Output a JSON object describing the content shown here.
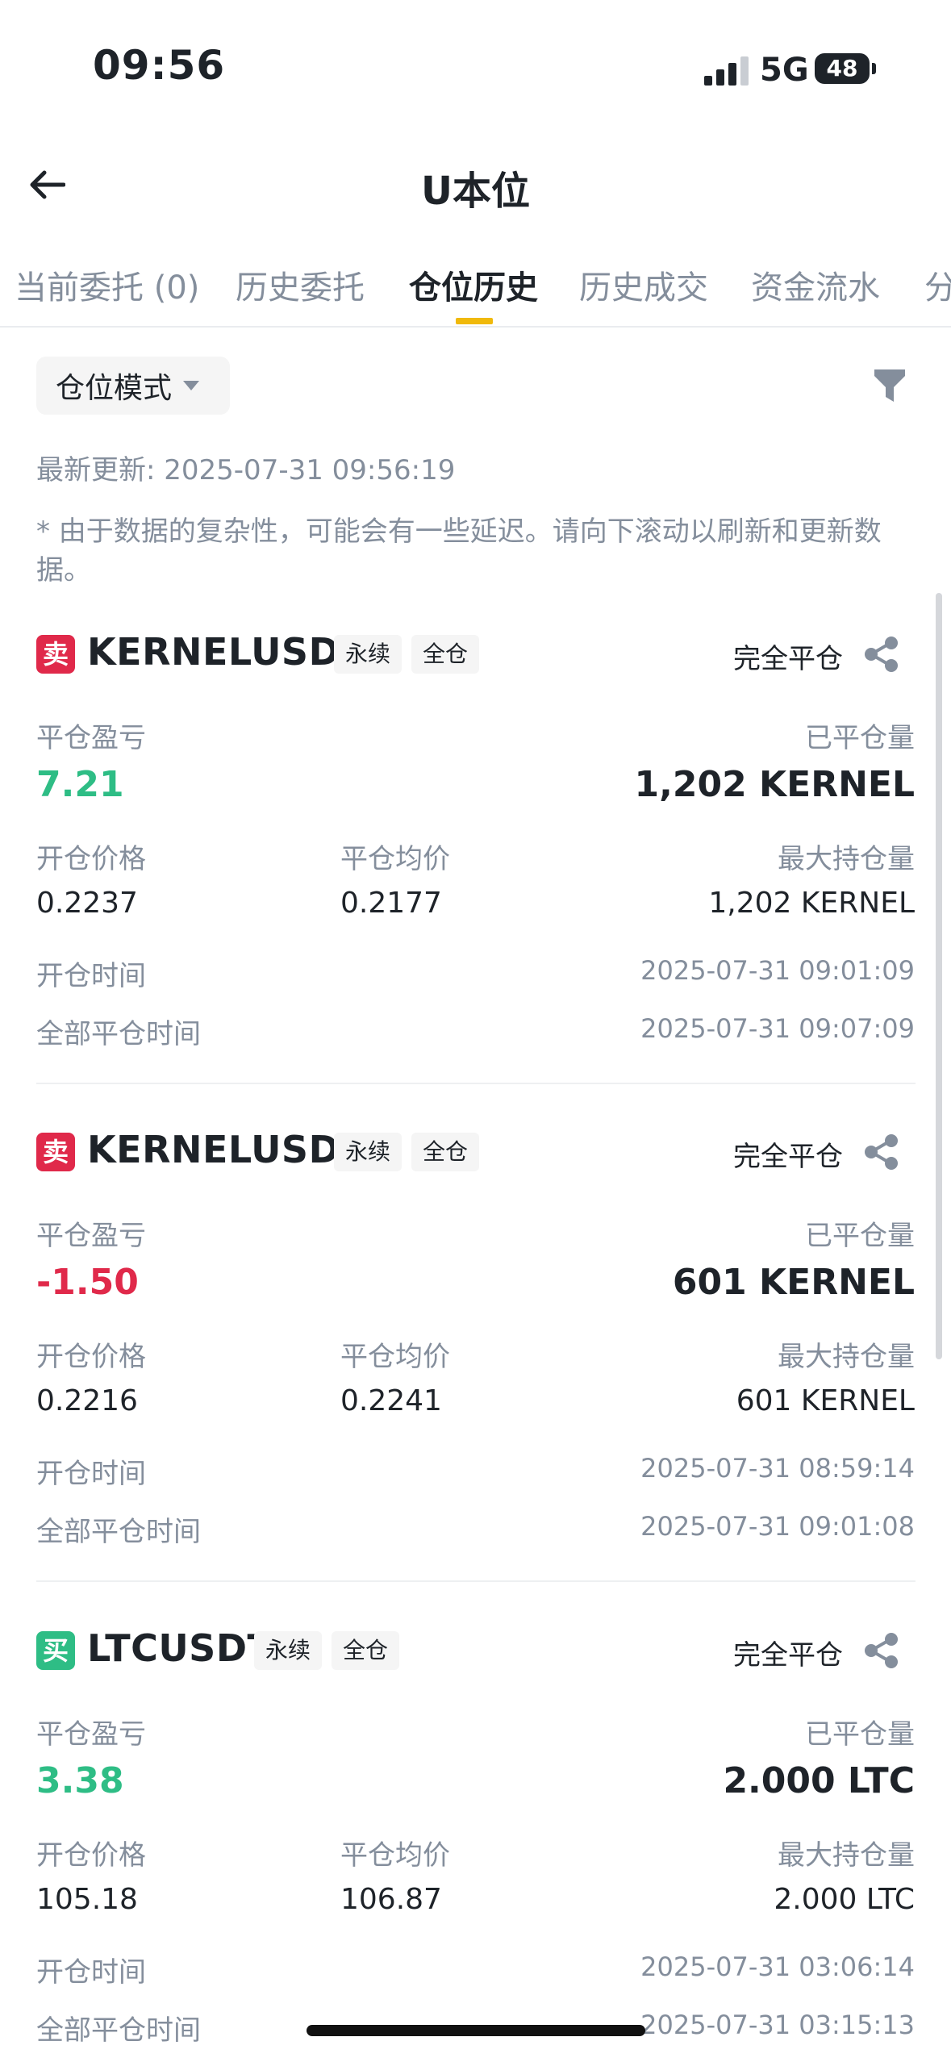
{
  "status_bar": {
    "time": "09:56",
    "network": "5G",
    "battery": "48"
  },
  "header": {
    "title": "U本位"
  },
  "tabs": [
    {
      "label": "当前委托 (0)"
    },
    {
      "label": "历史委托"
    },
    {
      "label": "仓位历史"
    },
    {
      "label": "历史成交"
    },
    {
      "label": "资金流水"
    },
    {
      "label": "分"
    }
  ],
  "filter": {
    "mode_label": "仓位模式"
  },
  "updated_text": "最新更新: 2025-07-31 09:56:19",
  "notice_text": "* 由于数据的复杂性，可能会有一些延迟。请向下滚动以刷新和更新数据。",
  "labels": {
    "pnl": "平仓盈亏",
    "closed_qty": "已平仓量",
    "open_price": "开仓价格",
    "close_avg": "平仓均价",
    "max_qty": "最大持仓量",
    "open_time": "开仓时间",
    "close_time": "全部平仓时间"
  },
  "positions": [
    {
      "side": "卖",
      "symbol": "KERNELUSDT",
      "tag1": "永续",
      "tag2": "全仓",
      "status": "完全平仓",
      "pnl": "7.21",
      "closed_qty": "1,202 KERNEL",
      "open_price": "0.2237",
      "close_avg": "0.2177",
      "max_qty": "1,202 KERNEL",
      "open_time": "2025-07-31 09:01:09",
      "close_time": "2025-07-31 09:07:09"
    },
    {
      "side": "卖",
      "symbol": "KERNELUSDT",
      "tag1": "永续",
      "tag2": "全仓",
      "status": "完全平仓",
      "pnl": "-1.50",
      "closed_qty": "601 KERNEL",
      "open_price": "0.2216",
      "close_avg": "0.2241",
      "max_qty": "601 KERNEL",
      "open_time": "2025-07-31 08:59:14",
      "close_time": "2025-07-31 09:01:08"
    },
    {
      "side": "买",
      "symbol": "LTCUSDT",
      "tag1": "永续",
      "tag2": "全仓",
      "status": "完全平仓",
      "pnl": "3.38",
      "closed_qty": "2.000 LTC",
      "open_price": "105.18",
      "close_avg": "106.87",
      "max_qty": "2.000 LTC",
      "open_time": "2025-07-31 03:06:14",
      "close_time": "2025-07-31 03:15:13"
    }
  ],
  "colors": {
    "positive": "#2ebd85",
    "negative": "#e0294a",
    "accent": "#f0b90b"
  }
}
